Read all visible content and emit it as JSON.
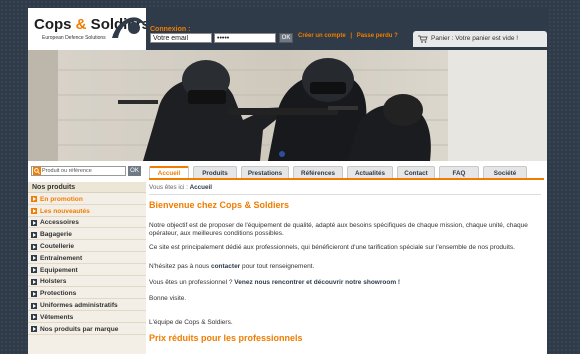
{
  "logo": {
    "name_part1": "Cops ",
    "name_amp": "&",
    "name_part2": " Soldiers",
    "tagline": "European Defence Solutions"
  },
  "login": {
    "label": "Connexion :",
    "email_value": "Votre email",
    "password_value": "•••••",
    "ok_label": "OK",
    "create_account": "Créer un compte",
    "separator": "|",
    "forgot_password": "Passe perdu ?"
  },
  "cart": {
    "label": "Panier : Votre panier est vide !"
  },
  "search": {
    "placeholder": "Produit ou référence",
    "ok_label": "OK"
  },
  "sidebar": {
    "title": "Nos produits",
    "items": [
      {
        "label": "En promotion",
        "hot": true
      },
      {
        "label": "Les nouveautés",
        "hot": true
      },
      {
        "label": "Accessoires",
        "hot": false
      },
      {
        "label": "Bagagerie",
        "hot": false
      },
      {
        "label": "Coutellerie",
        "hot": false
      },
      {
        "label": "Entraînement",
        "hot": false
      },
      {
        "label": "Equipement",
        "hot": false
      },
      {
        "label": "Holsters",
        "hot": false
      },
      {
        "label": "Protections",
        "hot": false
      },
      {
        "label": "Uniformes administratifs",
        "hot": false
      },
      {
        "label": "Vêtements",
        "hot": false
      },
      {
        "label": "Nos produits par marque",
        "hot": false
      }
    ]
  },
  "tabs": [
    {
      "label": "Accueil",
      "active": true
    },
    {
      "label": "Produits",
      "active": false
    },
    {
      "label": "Prestations",
      "active": false
    },
    {
      "label": "Références",
      "active": false
    },
    {
      "label": "Actualités",
      "active": false
    },
    {
      "label": "Contact",
      "active": false
    },
    {
      "label": "FAQ",
      "active": false
    },
    {
      "label": "Société",
      "active": false
    }
  ],
  "breadcrumb": {
    "prefix": "Vous êtes ici : ",
    "current": "Accueil"
  },
  "content": {
    "title": "Bienvenue chez Cops & Soldiers",
    "p1": "Notre objectif est de proposer de l'équipement de qualité, adapté aux besoins spécifiques de chaque mission, chaque unité, chaque opérateur, aux meilleures conditions possibles.",
    "p2": "Ce site est principalement dédié aux professionnels, qui bénéficieront d'une tarification spéciale sur l'ensemble de nos produits.",
    "p3_before": "N'hésitez pas à nous ",
    "p3_link": "contacter",
    "p3_after": " pour tout renseignement.",
    "p4_before": "Vous êtes un professionnel ? ",
    "p4_link": "Venez nous rencontrer et découvrir notre showroom !",
    "p5": "Bonne visite.",
    "p6": "L'équipe de Cops & Soldiers.",
    "subtitle": "Prix réduits pour les professionnels"
  },
  "colors": {
    "accent": "#f07d00",
    "dark": "#2f3b48"
  }
}
